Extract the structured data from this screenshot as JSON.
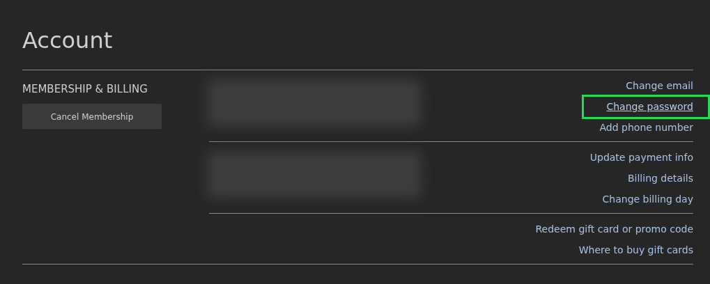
{
  "title": "Account",
  "section": {
    "heading": "MEMBERSHIP & BILLING",
    "button": "Cancel Membership",
    "groups": [
      {
        "redacted": true,
        "links": [
          {
            "label": "Change email",
            "hovered": false,
            "highlighted": false
          },
          {
            "label": "Change password",
            "hovered": true,
            "highlighted": true
          },
          {
            "label": "Add phone number",
            "hovered": false,
            "highlighted": false
          }
        ]
      },
      {
        "redacted": true,
        "links": [
          {
            "label": "Update payment info",
            "hovered": false,
            "highlighted": false
          },
          {
            "label": "Billing details",
            "hovered": false,
            "highlighted": false
          },
          {
            "label": "Change billing day",
            "hovered": false,
            "highlighted": false
          }
        ]
      },
      {
        "links": [
          {
            "label": "Redeem gift card or promo code",
            "hovered": false,
            "highlighted": false
          },
          {
            "label": "Where to buy gift cards",
            "hovered": false,
            "highlighted": false
          }
        ]
      }
    ]
  }
}
